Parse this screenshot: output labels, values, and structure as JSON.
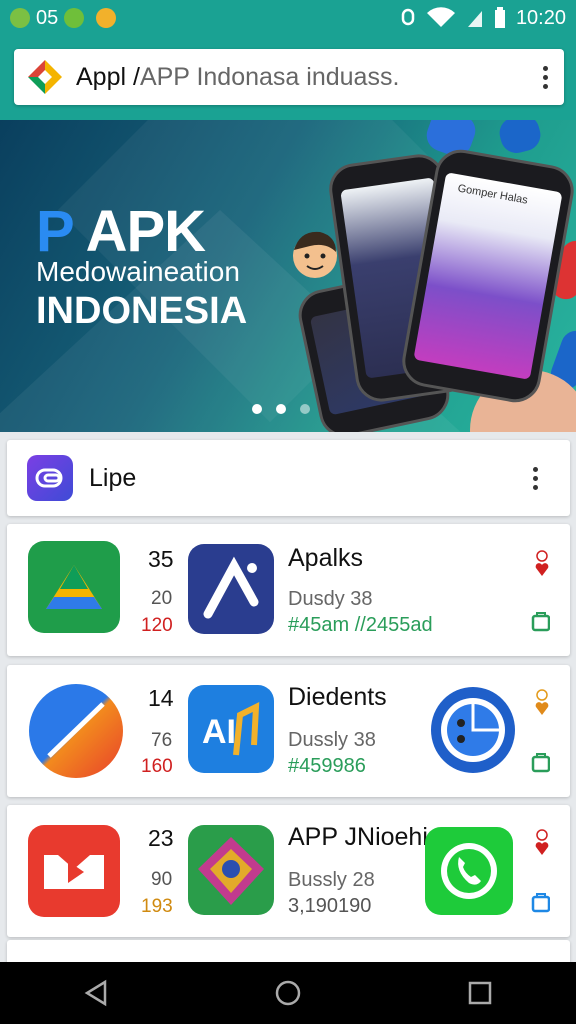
{
  "status": {
    "left_text": "05",
    "time": "10:20"
  },
  "search": {
    "value": "Appl /",
    "placeholder": "APP Indonasa induass."
  },
  "banner": {
    "title_accent": "P",
    "title": "APK",
    "subtitle": "Medowaineation",
    "subtitle2": "INDONESIA",
    "phone_label": "Gomper Halas"
  },
  "lipe": {
    "label": "Lipe"
  },
  "apps": [
    {
      "num": "35",
      "sub": "20",
      "alt": "120",
      "name": "Apalks",
      "meta": "Dusdy 38",
      "extra": "#45am //2455ad"
    },
    {
      "num": "14",
      "sub": "76",
      "alt": "160",
      "name": "Diedents",
      "meta": "Dussly 38",
      "extra": "#459986"
    },
    {
      "num": "23",
      "sub": "90",
      "alt": "193",
      "name": "APP JNioehiars",
      "meta": "Bussly 28",
      "extra": "3,190190"
    }
  ],
  "colors": {
    "accent": "#1aa293",
    "red": "#d02020",
    "green": "#2a9d5a"
  }
}
